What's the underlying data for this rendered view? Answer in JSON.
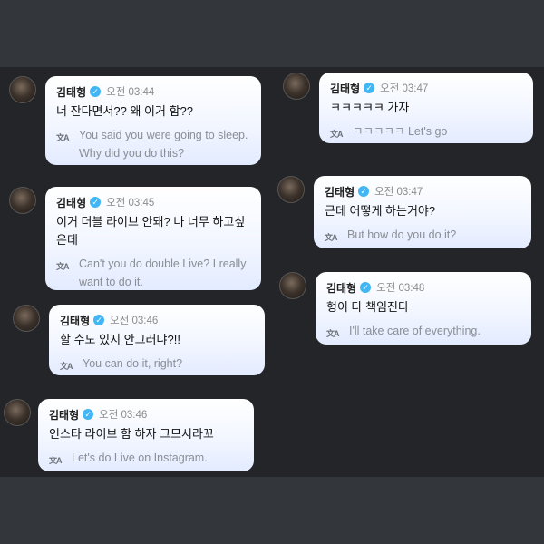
{
  "messages": [
    {
      "name": "김태형",
      "time": "오전 03:44",
      "text": "너 잔다면서?? 왜 이거 함??",
      "translation": "You said you were going to sleep. Why did you do this?"
    },
    {
      "name": "김태형",
      "time": "오전 03:45",
      "text": "이거 더블 라이브 안돼? 나 너무 하고싶은데",
      "translation": "Can't you do double Live? I really want to do it."
    },
    {
      "name": "김태형",
      "time": "오전 03:46",
      "text": "할 수도 있지 안그러냐?!!",
      "translation": "You can do it, right?"
    },
    {
      "name": "김태형",
      "time": "오전 03:46",
      "text": "인스타 라이브 함 하자 그므시라꼬",
      "translation": "Let's do Live on Instagram."
    },
    {
      "name": "김태형",
      "time": "오전 03:47",
      "text": "ㅋㅋㅋㅋㅋ 가자",
      "translation": "ㅋㅋㅋㅋㅋ Let's go"
    },
    {
      "name": "김태형",
      "time": "오전 03:47",
      "text": "근데 어떻게 하는거야?",
      "translation": "But how do you do it?"
    },
    {
      "name": "김태형",
      "time": "오전 03:48",
      "text": "형이 다 책임진다",
      "translation": "I'll take care of everything."
    }
  ],
  "icons": {
    "verified": "verified-check-icon",
    "translate": "translate-icon"
  },
  "colors": {
    "background": "#232528",
    "bubble": "#eaf0ff",
    "verified": "#40b6f5"
  }
}
